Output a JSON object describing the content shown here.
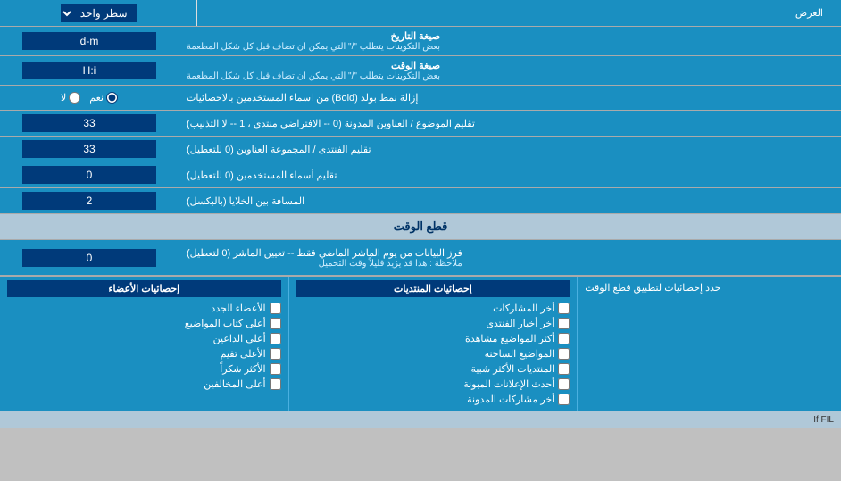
{
  "header": {
    "dropdown_label": "سطر واحد",
    "section_label": "العرض"
  },
  "rows": [
    {
      "id": "date_format",
      "label": "صيغة التاريخ",
      "sublabel": "بعض التكوينات يتطلب \"/\" التي يمكن ان تضاف قبل كل شكل المطعمة",
      "value": "d-m",
      "type": "text"
    },
    {
      "id": "time_format",
      "label": "صيغة الوقت",
      "sublabel": "بعض التكوينات يتطلب \"/\" التي يمكن ان تضاف قبل كل شكل المطعمة",
      "value": "H:i",
      "type": "text"
    },
    {
      "id": "bold_remove",
      "label": "إزالة نمط بولد (Bold) من اسماء المستخدمين بالاحصائيات",
      "type": "radio",
      "options": [
        "نعم",
        "لا"
      ],
      "selected": "نعم"
    },
    {
      "id": "topic_count",
      "label": "تقليم الموضوع / العناوين المدونة (0 -- الافتراضي منتدى ، 1 -- لا التذنيب)",
      "value": "33",
      "type": "text"
    },
    {
      "id": "forum_count",
      "label": "تقليم الفنتدى / المجموعة العناوين (0 للتعطيل)",
      "value": "33",
      "type": "text"
    },
    {
      "id": "usernames_trim",
      "label": "تقليم أسماء المستخدمين (0 للتعطيل)",
      "value": "0",
      "type": "text"
    },
    {
      "id": "cell_distance",
      "label": "المسافة بين الخلايا (بالبكسل)",
      "value": "2",
      "type": "text"
    }
  ],
  "cutoff_section": {
    "title": "قطع الوقت",
    "row": {
      "label": "فرز البيانات من يوم الماشر الماضي فقط -- تعيين الماشر (0 لتعطيل)",
      "note": "ملاحظة : هذا قد يزيد قليلاً وقت التحميل",
      "value": "0"
    }
  },
  "stats_section": {
    "label": "حدد إحصائيات لتطبيق قطع الوقت",
    "col1_header": "إحصائيات المنتديات",
    "col1_items": [
      "أخر المشاركات",
      "أخر أخبار الفنتدى",
      "أكثر المواضيع مشاهدة",
      "المواضيع الساخنة",
      "المنتديات الأكثر شبية",
      "أحدث الإعلانات المبونة",
      "أخر مشاركات المدونة"
    ],
    "col2_header": "إحصائيات الأعضاء",
    "col2_items": [
      "الأعضاء الجدد",
      "أعلى كتاب المواضيع",
      "أعلى الداعين",
      "الأعلى تقيم",
      "الأكثر شكراً",
      "أعلى المخالفين"
    ],
    "col3_header": "",
    "col3_items": []
  }
}
